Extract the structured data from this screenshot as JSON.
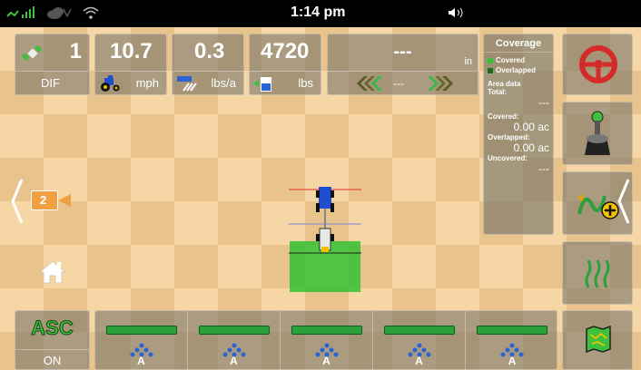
{
  "status": {
    "time": "1:14 pm"
  },
  "gps": {
    "satellites": "1",
    "mode": "DIF"
  },
  "speed": {
    "value": "10.7",
    "unit": "mph"
  },
  "rate": {
    "value": "0.3",
    "unit": "lbs/a"
  },
  "weight": {
    "value": "4720",
    "unit": "lbs"
  },
  "guidance": {
    "value": "---",
    "unit": "in",
    "offset": "---"
  },
  "coverage": {
    "title": "Coverage",
    "legend_covered": "Covered",
    "legend_overlapped": "Overlapped",
    "area_data": "Area data",
    "total_label": "Total:",
    "total_value": "---",
    "covered_label": "Covered:",
    "covered_value": "0.00 ac",
    "overlapped_label": "Overlapped:",
    "overlapped_value": "0.00 ac",
    "uncovered_label": "Uncovered:",
    "uncovered_value": "---"
  },
  "camera": {
    "number": "2"
  },
  "asc": {
    "label": "ASC",
    "state": "ON"
  },
  "sections": [
    {
      "mode": "A"
    },
    {
      "mode": "A"
    },
    {
      "mode": "A"
    },
    {
      "mode": "A"
    },
    {
      "mode": "A"
    }
  ],
  "colors": {
    "covered": "#32c232",
    "overlapped": "#1e6b1e",
    "section_on": "#2aa13a",
    "guidance_arrow_left": "#5b5b2a",
    "guidance_arrow_right": "#36b84a"
  },
  "icons": {
    "signal": "signal-icon",
    "cloud": "cloud-icon",
    "wifi": "wifi-icon",
    "volume": "volume-icon",
    "satellite": "satellite-icon",
    "tractor": "tractor-icon",
    "spreader": "spreader-icon",
    "tank": "tank-icon",
    "steering_wheel": "steering-wheel-icon",
    "joystick": "joystick-icon",
    "path_plus": "path-plus-icon",
    "heat": "heat-icon",
    "map": "map-icon",
    "camera": "camera-icon",
    "home": "home-icon"
  }
}
